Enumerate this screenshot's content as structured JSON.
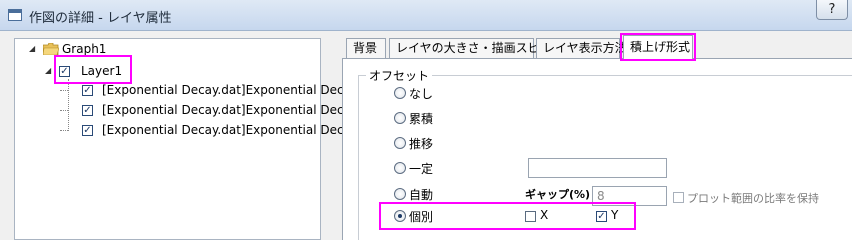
{
  "window": {
    "title": "作図の詳細 - レイヤ属性",
    "help_label": "?"
  },
  "tree": {
    "root": "Graph1",
    "layer": "Layer1",
    "plots": [
      "[Exponential Decay.dat]Exponential Decay!",
      "[Exponential Decay.dat]Exponential Decay!",
      "[Exponential Decay.dat]Exponential Decay!"
    ]
  },
  "tabs": [
    {
      "label": "背景",
      "active": false
    },
    {
      "label": "レイヤの大きさ・描画スピード",
      "active": false
    },
    {
      "label": "レイヤ表示方法",
      "active": false
    },
    {
      "label": "積上げ形式",
      "active": true
    }
  ],
  "offset": {
    "group_label": "オフセット",
    "options": [
      {
        "label": "なし",
        "selected": false
      },
      {
        "label": "累積",
        "selected": false
      },
      {
        "label": "推移",
        "selected": false
      },
      {
        "label": "一定",
        "selected": false
      },
      {
        "label": "自動",
        "selected": false
      },
      {
        "label": "個別",
        "selected": true
      }
    ],
    "constant_value": "",
    "gap_label": "ギャップ(%)",
    "gap_value": "8",
    "keep_ratio_label": "プロット範囲の比率を保持",
    "x_label": "X",
    "y_label": "Y"
  },
  "colors": {
    "highlight": "#ff00ff",
    "titlebar": "#c6d7ee",
    "panel_bg": "#f0f0f0"
  }
}
